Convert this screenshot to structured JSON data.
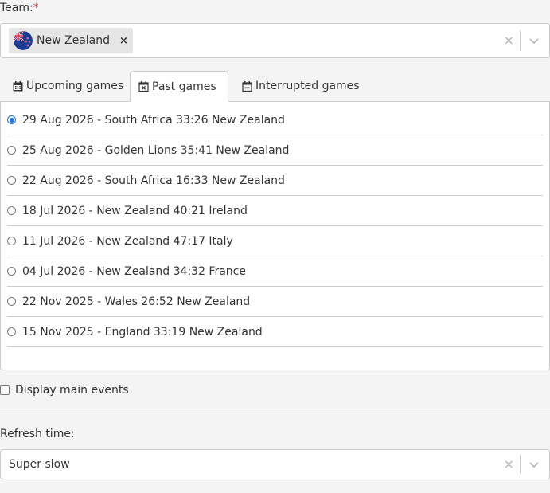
{
  "team": {
    "label": "Team:",
    "required_mark": "*",
    "selected": "New Zealand",
    "chip_remove": "×",
    "clear_icon": "×"
  },
  "tabs": [
    {
      "label": "Upcoming games",
      "icon": "calendar-icon",
      "active": false
    },
    {
      "label": "Past games",
      "icon": "calendar-x-icon",
      "active": true
    },
    {
      "label": "Interrupted games",
      "icon": "calendar-minus-icon",
      "active": false
    }
  ],
  "games": [
    {
      "text": "29 Aug 2026 - South Africa 33:26 New Zealand",
      "selected": true
    },
    {
      "text": "25 Aug 2026 - Golden Lions 35:41 New Zealand",
      "selected": false
    },
    {
      "text": "22 Aug 2026 - South Africa 16:33 New Zealand",
      "selected": false
    },
    {
      "text": "18 Jul 2026 - New Zealand 40:21 Ireland",
      "selected": false
    },
    {
      "text": "11 Jul 2026 - New Zealand 47:17 Italy",
      "selected": false
    },
    {
      "text": "04 Jul 2026 - New Zealand 34:32 France",
      "selected": false
    },
    {
      "text": "22 Nov 2025 - Wales 26:52 New Zealand",
      "selected": false
    },
    {
      "text": "15 Nov 2025 - England 33:19 New Zealand",
      "selected": false
    }
  ],
  "display_main_events": {
    "label": "Display main events",
    "checked": false
  },
  "refresh": {
    "label": "Refresh time:",
    "value": "Super slow",
    "clear_icon": "×"
  },
  "colors": {
    "accent": "#1a73e8",
    "required": "#d9342b"
  }
}
